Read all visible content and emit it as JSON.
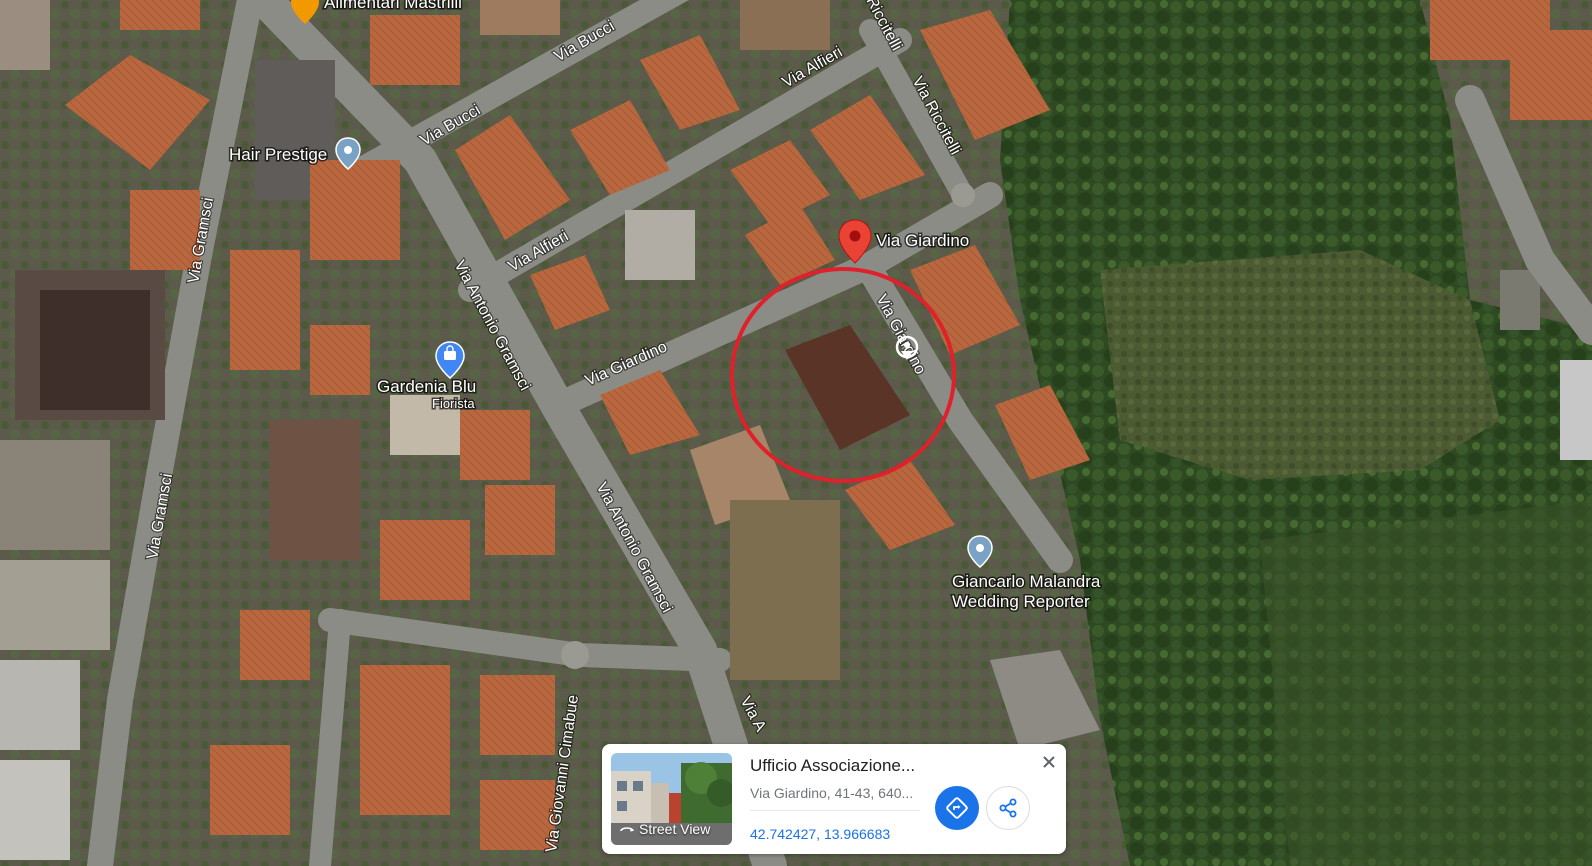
{
  "map": {
    "streets": [
      {
        "id": "via-bucci-1",
        "label": "Via Bucci"
      },
      {
        "id": "via-bucci-2",
        "label": "Via Bucci"
      },
      {
        "id": "via-alfieri-1",
        "label": "Via Alfieri"
      },
      {
        "id": "via-alfieri-2",
        "label": "Via Alfieri"
      },
      {
        "id": "via-riccitelli-1",
        "label": "Via Riccitelli"
      },
      {
        "id": "via-riccitelli-top",
        "label": "Riccitelli"
      },
      {
        "id": "via-giardino-1",
        "label": "Via Giardino"
      },
      {
        "id": "via-giardino-2",
        "label": "Via Giardino"
      },
      {
        "id": "via-gramsci-1",
        "label": "Via Gramsci"
      },
      {
        "id": "via-gramsci-2",
        "label": "Via Gramsci"
      },
      {
        "id": "via-antonio-gramsci-1",
        "label": "Via Antonio Gramsci"
      },
      {
        "id": "via-antonio-gramsci-2",
        "label": "Via Antonio Gramsci"
      },
      {
        "id": "via-giovanni-cimabue",
        "label": "Via Giovanni Cimabue"
      },
      {
        "id": "via-antonio-gramsci-3",
        "label": "Via A"
      }
    ],
    "pois": [
      {
        "id": "alimentari",
        "label": "Alimentari Mastrilli",
        "icon": "shop-pin-icon",
        "color": "#f29900"
      },
      {
        "id": "hair-prestige",
        "label": "Hair Prestige",
        "icon": "place-pin-icon",
        "color": "#7aa2c4"
      },
      {
        "id": "gardenia-blu",
        "label": "Gardenia Blu",
        "sublabel": "Fiorista",
        "icon": "shopping-bag-pin-icon",
        "color": "#4285f4"
      },
      {
        "id": "via-giardino-pin",
        "label": "Via Giardino",
        "icon": "red-location-pin-icon",
        "color": "#ea4335"
      },
      {
        "id": "giancarlo",
        "label": "Giancarlo Malandra",
        "sublabel": "Wedding Reporter",
        "icon": "place-pin-icon",
        "color": "#7aa2c4"
      }
    ],
    "highlight_circle_color": "#e0202a"
  },
  "card": {
    "title": "Ufficio Associazione...",
    "address": "Via Giardino, 41-43, 640...",
    "coordinates": "42.742427, 13.966683",
    "street_view_label": "Street View",
    "directions_icon": "directions-icon",
    "share_icon": "share-icon",
    "close_icon": "close-icon",
    "accent_color": "#1a73e8"
  }
}
